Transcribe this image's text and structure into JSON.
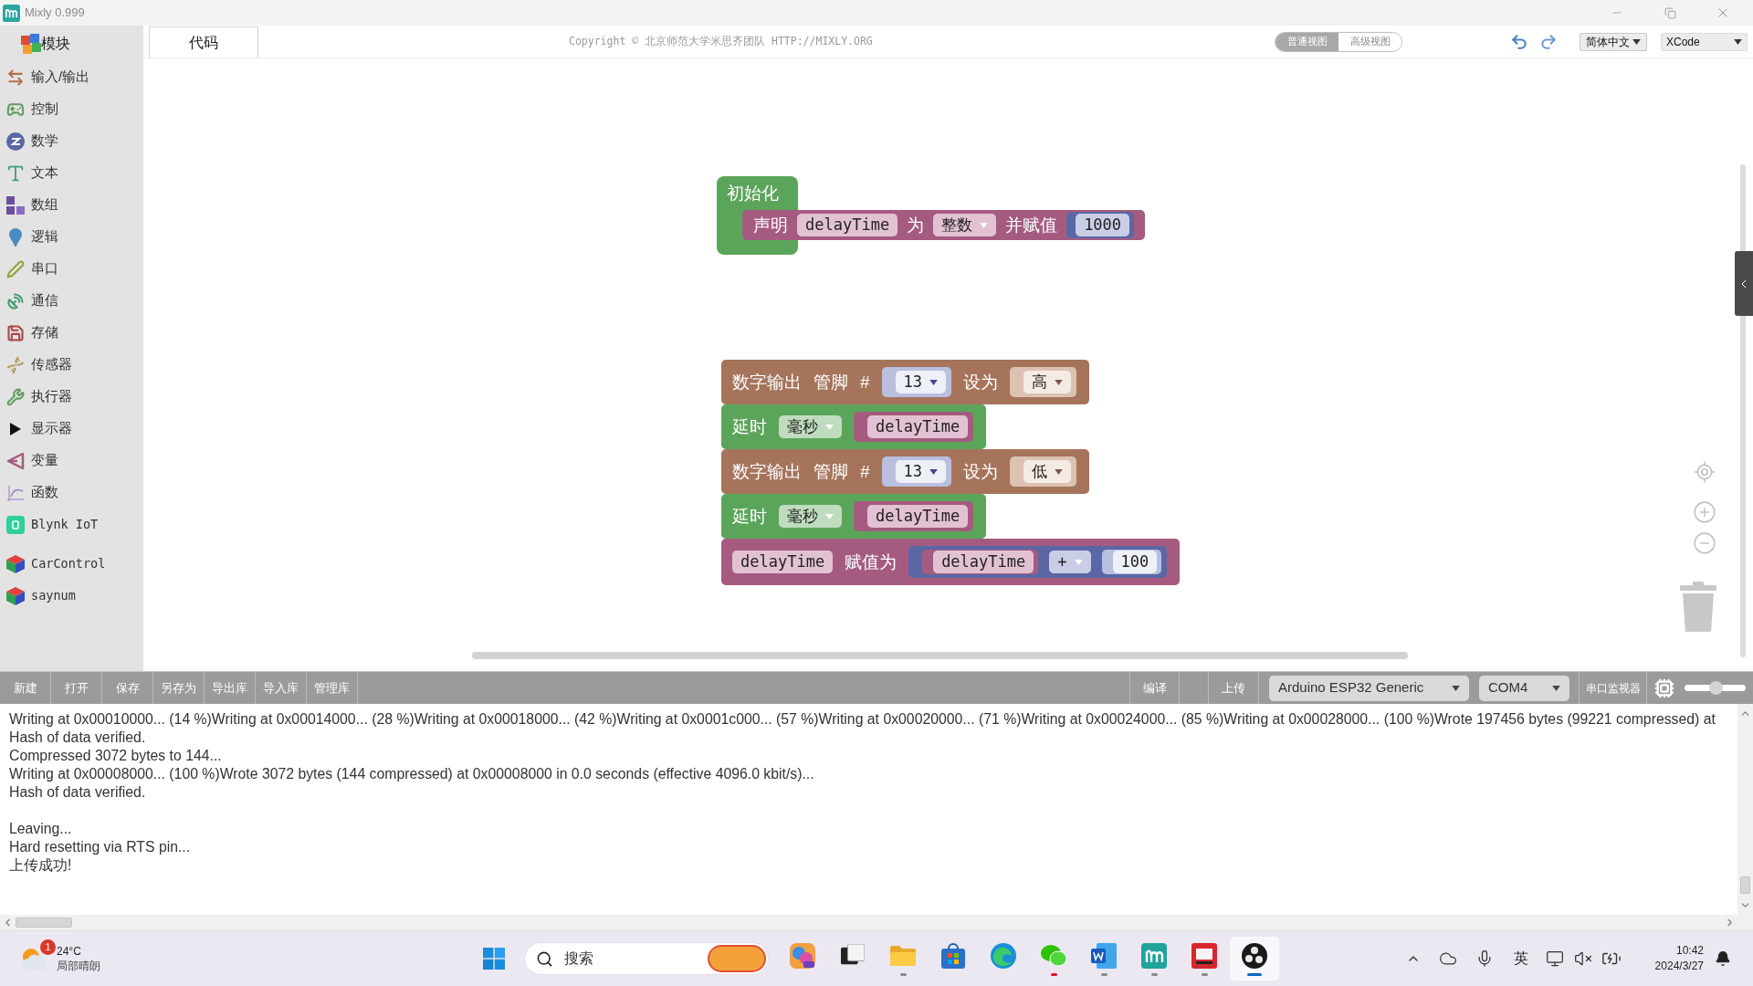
{
  "window": {
    "title": "Mixly 0.999"
  },
  "sidebar": {
    "title": "模块",
    "groups": [
      {
        "items": [
          {
            "label": "输入/输出",
            "kind": "category"
          },
          {
            "label": "控制",
            "kind": "category"
          },
          {
            "label": "数学",
            "kind": "category"
          },
          {
            "label": "文本",
            "kind": "category"
          },
          {
            "label": "数组",
            "kind": "category"
          },
          {
            "label": "逻辑",
            "kind": "category"
          },
          {
            "label": "串口",
            "kind": "category"
          },
          {
            "label": "通信",
            "kind": "category"
          },
          {
            "label": "存储",
            "kind": "category"
          },
          {
            "label": "传感器",
            "kind": "category"
          },
          {
            "label": "执行器",
            "kind": "category"
          },
          {
            "label": "显示器",
            "kind": "category"
          },
          {
            "label": "变量",
            "kind": "category"
          },
          {
            "label": "函数",
            "kind": "category"
          },
          {
            "label": "Blynk IoT",
            "kind": "library"
          }
        ]
      },
      {
        "items": [
          {
            "label": "CarControl",
            "kind": "library"
          },
          {
            "label": "saynum",
            "kind": "library"
          }
        ]
      }
    ]
  },
  "editor": {
    "tabs": [
      {
        "label": "代码",
        "selected": true
      }
    ],
    "copyright": "Copyright © 北京师范大学米思齐团队 HTTP://MIXLY.ORG",
    "views": [
      {
        "label": "普通视图",
        "selected": true
      },
      {
        "label": "高级视图",
        "selected": false
      }
    ],
    "language": "简体中文",
    "code_theme": "XCode"
  },
  "workspace": {
    "stacks": [
      {
        "kind": "setup",
        "label": "初始化",
        "statements": [
          {
            "kind": "variable",
            "parts": [
              {
                "kind": "text",
                "text": "声明"
              },
              {
                "kind": "field",
                "text": "delayTime"
              },
              {
                "kind": "text",
                "text": "为"
              },
              {
                "kind": "dropdown",
                "text": "整数"
              },
              {
                "kind": "text",
                "text": "并赋值"
              },
              {
                "kind": "input",
                "block": {
                  "kind": "math",
                  "parts": [
                    {
                      "kind": "field",
                      "text": "1000"
                    }
                  ]
                }
              }
            ]
          }
        ]
      },
      {
        "kind": "sequence",
        "statements": [
          {
            "kind": "io",
            "parts": [
              {
                "kind": "text",
                "text": "数字输出"
              },
              {
                "kind": "text",
                "text": "管脚"
              },
              {
                "kind": "text",
                "text": "#"
              },
              {
                "kind": "input",
                "block": {
                  "kind": "number",
                  "parts": [
                    {
                      "kind": "dropdown",
                      "text": "13"
                    }
                  ]
                }
              },
              {
                "kind": "text",
                "text": "设为"
              },
              {
                "kind": "input",
                "block": {
                  "kind": "level",
                  "parts": [
                    {
                      "kind": "dropdown",
                      "text": "高"
                    }
                  ]
                }
              }
            ]
          },
          {
            "kind": "control",
            "parts": [
              {
                "kind": "text",
                "text": "延时"
              },
              {
                "kind": "dropdown",
                "text": "毫秒"
              },
              {
                "kind": "input",
                "block": {
                  "kind": "variable",
                  "parts": [
                    {
                      "kind": "field",
                      "text": "delayTime"
                    }
                  ]
                }
              }
            ]
          },
          {
            "kind": "io",
            "parts": [
              {
                "kind": "text",
                "text": "数字输出"
              },
              {
                "kind": "text",
                "text": "管脚"
              },
              {
                "kind": "text",
                "text": "#"
              },
              {
                "kind": "input",
                "block": {
                  "kind": "number",
                  "parts": [
                    {
                      "kind": "dropdown",
                      "text": "13"
                    }
                  ]
                }
              },
              {
                "kind": "text",
                "text": "设为"
              },
              {
                "kind": "input",
                "block": {
                  "kind": "level",
                  "parts": [
                    {
                      "kind": "dropdown",
                      "text": "低"
                    }
                  ]
                }
              }
            ]
          },
          {
            "kind": "control",
            "parts": [
              {
                "kind": "text",
                "text": "延时"
              },
              {
                "kind": "dropdown",
                "text": "毫秒"
              },
              {
                "kind": "input",
                "block": {
                  "kind": "variable",
                  "parts": [
                    {
                      "kind": "field",
                      "text": "delayTime"
                    }
                  ]
                }
              }
            ]
          },
          {
            "kind": "variable",
            "parts": [
              {
                "kind": "field",
                "text": "delayTime"
              },
              {
                "kind": "text",
                "text": "赋值为"
              },
              {
                "kind": "input",
                "block": {
                  "kind": "math",
                  "parts": [
                    {
                      "kind": "input",
                      "block": {
                        "kind": "variable",
                        "parts": [
                          {
                            "kind": "field",
                            "text": "delayTime"
                          }
                        ]
                      }
                    },
                    {
                      "kind": "dropdown",
                      "text": "+"
                    },
                    {
                      "kind": "input",
                      "block": {
                        "kind": "number",
                        "parts": [
                          {
                            "kind": "field",
                            "text": "100"
                          }
                        ]
                      }
                    }
                  ]
                }
              }
            ]
          }
        ]
      }
    ]
  },
  "toolbar": {
    "left_buttons": [
      "新建",
      "打开",
      "保存",
      "另存为",
      "导出库",
      "导入库",
      "管理库"
    ],
    "compile": "编译",
    "upload": "上传",
    "board": "Arduino ESP32 Generic",
    "port": "COM4",
    "serial_monitor": "串口监视器",
    "slider": {
      "level": 0.5
    }
  },
  "console": {
    "paragraphs": [
      [
        "Writing at 0x00010000... (14 %)Writing at 0x00014000... (28 %)Writing at 0x00018000... (42 %)Writing at 0x0001c000... (57 %)Writing at 0x00020000... (71 %)Writing at 0x00024000... (85 %)Writing at 0x00028000... (100 %)Wrote 197456 bytes (99221 compressed) at",
        "Hash of data verified.",
        "Compressed 3072 bytes to 144...",
        "Writing at 0x00008000... (100 %)Wrote 3072 bytes (144 compressed) at 0x00008000 in 0.0 seconds (effective 4096.0 kbit/s)...",
        "Hash of data verified."
      ],
      [
        "Leaving...",
        "Hard resetting via RTS pin...",
        "上传成功!"
      ]
    ]
  },
  "taskbar": {
    "weather": {
      "badge": "1",
      "temperature": "24°C",
      "condition": "局部晴朗"
    },
    "search": {
      "placeholder": "搜索"
    },
    "apps": [
      {
        "running": false,
        "selected": false
      },
      {
        "running": false,
        "selected": false
      },
      {
        "running": true,
        "selected": false,
        "color": "#8a8a8a"
      },
      {
        "running": false,
        "selected": false
      },
      {
        "running": false,
        "selected": false
      },
      {
        "running": true,
        "selected": false,
        "color": "#e81123"
      },
      {
        "running": true,
        "selected": false,
        "color": "#8a8a8a"
      },
      {
        "running": true,
        "selected": false,
        "color": "#8a8a8a"
      },
      {
        "running": true,
        "selected": false,
        "color": "#8a8a8a"
      },
      {
        "running": true,
        "selected": true,
        "color": "#0067c0"
      }
    ],
    "input_method": "英",
    "clock": {
      "time": "10:42",
      "date": "2024/3/27"
    }
  }
}
